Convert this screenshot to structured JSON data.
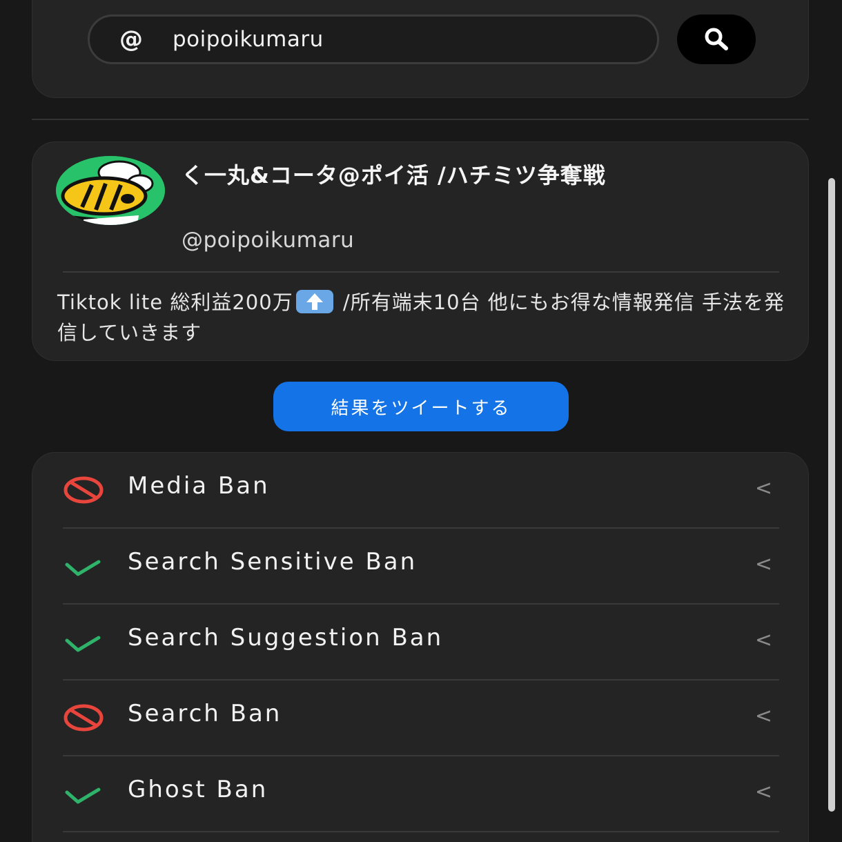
{
  "search": {
    "prefix": "@",
    "value": "poipoikumaru",
    "button_icon": "search-icon"
  },
  "profile": {
    "display_name": "く一丸&コータ@ポイ活 /ハチミツ争奪戦",
    "handle": "@poipoikumaru",
    "bio_part1": "Tiktok lite 総利益200万",
    "bio_emoji": "up-arrow-emoji",
    "bio_part2": " /所有端末10台 他にもお得な情報発信 手法を発信していきます"
  },
  "tweet_button": {
    "label": "結果をツイートする"
  },
  "results": [
    {
      "label": "Media Ban",
      "status": "banned",
      "chevron": "<"
    },
    {
      "label": "Search Sensitive Ban",
      "status": "ok",
      "chevron": "<"
    },
    {
      "label": "Search Suggestion Ban",
      "status": "ok",
      "chevron": "<"
    },
    {
      "label": "Search Ban",
      "status": "banned",
      "chevron": "<"
    },
    {
      "label": "Ghost Ban",
      "status": "ok",
      "chevron": "<"
    }
  ],
  "colors": {
    "banned": "#e8453c",
    "ok": "#2fb36b",
    "accent": "#1473e6"
  }
}
